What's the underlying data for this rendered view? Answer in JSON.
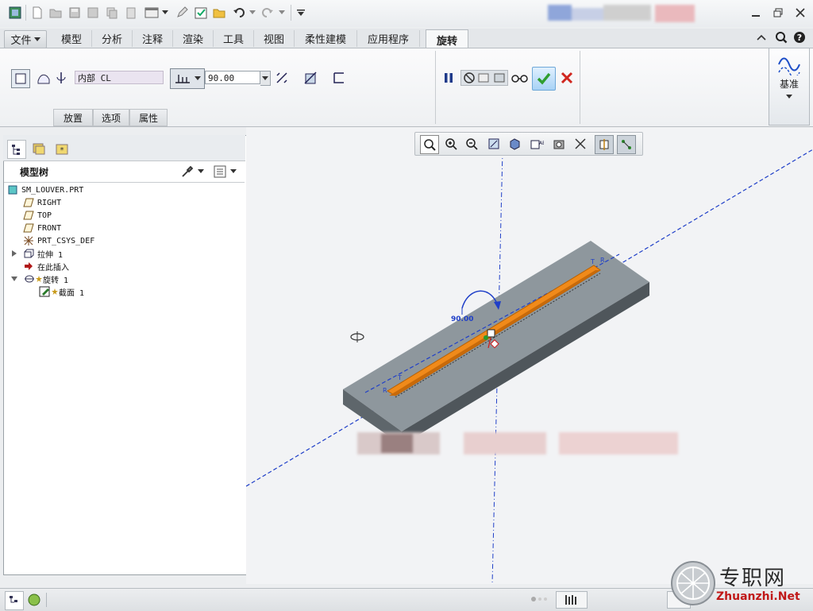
{
  "ribbon": {
    "file_tab": "文件",
    "tabs": [
      "模型",
      "分析",
      "注释",
      "渲染",
      "工具",
      "视图",
      "柔性建模",
      "应用程序"
    ],
    "active_tab": "旋转",
    "axis_field_value": "内部 CL",
    "angle_value": "90.00",
    "subtabs": [
      "放置",
      "选项",
      "属性"
    ],
    "datum_label": "基准"
  },
  "model_tree": {
    "title": "模型树",
    "items": [
      {
        "label": "SM_LOUVER.PRT",
        "icon": "part-icon"
      },
      {
        "label": "RIGHT",
        "icon": "datum-plane-icon"
      },
      {
        "label": "TOP",
        "icon": "datum-plane-icon"
      },
      {
        "label": "FRONT",
        "icon": "datum-plane-icon"
      },
      {
        "label": "PRT_CSYS_DEF",
        "icon": "csys-icon"
      },
      {
        "label": "拉伸 1",
        "icon": "extrude-icon"
      },
      {
        "label": "在此插入",
        "icon": "insert-arrow-icon"
      },
      {
        "label": "旋转 1",
        "icon": "revolve-icon"
      },
      {
        "label": "截面 1",
        "icon": "sketch-icon"
      }
    ]
  },
  "viewport": {
    "dimension_label": "90.00",
    "axis_labels": [
      "T",
      "R",
      "T",
      "R"
    ]
  },
  "watermark": {
    "text": "Zhuanzhi.Net",
    "brand": "专职网"
  },
  "colors": {
    "accent_orange": "#f08a1a",
    "plate_top": "#8e979d",
    "axis_blue": "#1f3fc8",
    "confirm_green": "#2f9e2f",
    "cancel_red": "#d0261e"
  }
}
